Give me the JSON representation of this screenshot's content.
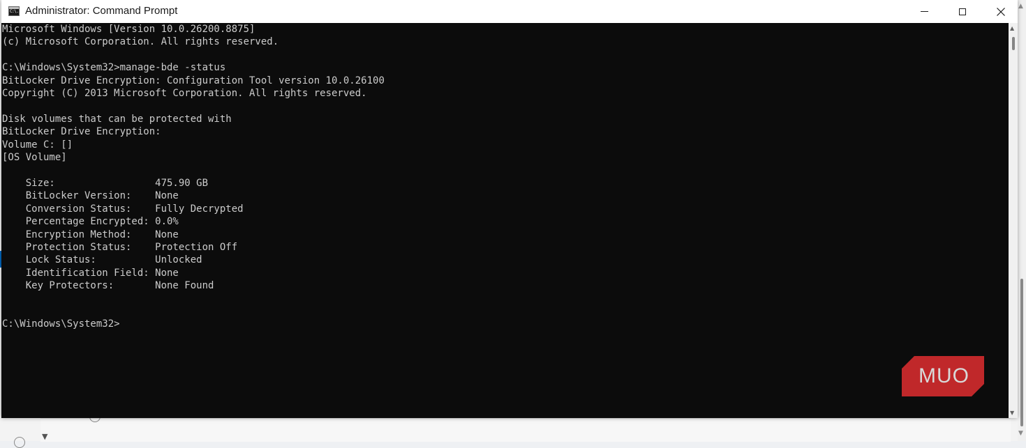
{
  "window": {
    "title": "Administrator: Command Prompt",
    "icon_text": "C:\\."
  },
  "controls": {
    "minimize": "minimize-icon",
    "maximize": "maximize-icon",
    "close_glyph": "✕"
  },
  "console": {
    "lines": [
      "Microsoft Windows [Version 10.0.26200.8875]",
      "(c) Microsoft Corporation. All rights reserved.",
      "",
      "C:\\Windows\\System32>manage-bde -status",
      "BitLocker Drive Encryption: Configuration Tool version 10.0.26100",
      "Copyright (C) 2013 Microsoft Corporation. All rights reserved.",
      "",
      "Disk volumes that can be protected with",
      "BitLocker Drive Encryption:",
      "Volume C: []",
      "[OS Volume]",
      "",
      "    Size:                 475.90 GB",
      "    BitLocker Version:    None",
      "    Conversion Status:    Fully Decrypted",
      "    Percentage Encrypted: 0.0%",
      "    Encryption Method:    None",
      "    Protection Status:    Protection Off",
      "    Lock Status:          Unlocked",
      "    Identification Field: None",
      "    Key Protectors:       None Found",
      "",
      "",
      "C:\\Windows\\System32>"
    ]
  },
  "watermark": {
    "text": "MUO",
    "color": "#c0282a"
  },
  "colors": {
    "console_bg": "#0c0c0c",
    "console_fg": "#cccccc",
    "titlebar_bg": "#ffffff"
  }
}
